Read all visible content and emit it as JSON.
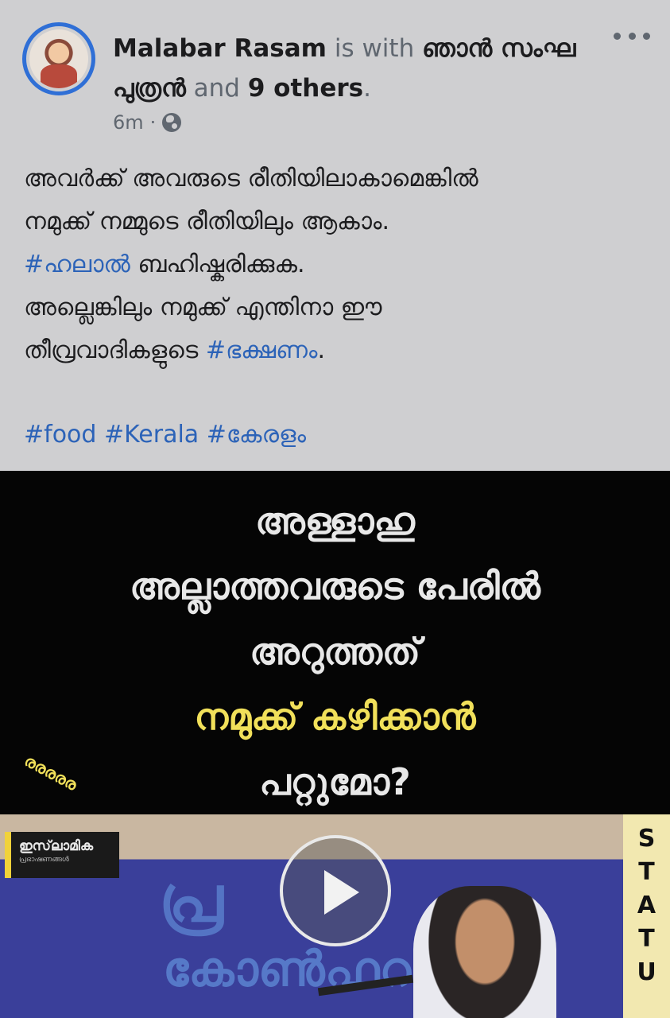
{
  "post": {
    "author": "Malabar Rasam",
    "is_with": "is with",
    "tagged_person": "ഞാൻ സംഘ പുത്രൻ",
    "and": "and",
    "others": "9 others",
    "period": ".",
    "time": "6m",
    "dot": "·",
    "line1": "അവർക്ക് അവരുടെ രീതിയിലാകാമെങ്കിൽ",
    "line2": "നമുക്ക് നമ്മുടെ രീതിയിലും ആകാം.",
    "line3_tag": "#ഹലാൽ",
    "line3_rest": " ബഹിഷ്കരിക്കുക.",
    "line4": "അല്ലെങ്കിലും നമുക്ക് എന്തിനാ ഈ",
    "line5_start": "തീവ്രവാദികളുടെ ",
    "line5_tag": "#ഭക്ഷണം",
    "line5_end": ".",
    "tags": "#food #Kerala #കേരളം"
  },
  "video": {
    "line1": "അള്ളാഹു",
    "line2": "അല്ലാത്തവരുടെ പേരിൽ",
    "line3": "അറുത്തത്",
    "line4": "നമുക്ക് കഴിക്കാൻ",
    "line5": "പറ്റുമോ?",
    "corner_text": "രരരരര",
    "channel_name": "ഇസ്‌ലാമിക",
    "channel_sub": "പ്രഭാഷണങ്ങൾ",
    "banner_letters": "പ്ര",
    "banner_sub": "കോൺഫറൻസ്",
    "status_letters": [
      "S",
      "T",
      "A",
      "T",
      "U"
    ]
  },
  "icons": {
    "more": "more-horizontal-icon",
    "privacy": "globe-icon",
    "play": "play-icon"
  },
  "colors": {
    "background": "#cfcfd1",
    "link": "#2c63b8",
    "avatar_ring": "#2f6fd6",
    "video_yellow": "#f1e05a"
  }
}
